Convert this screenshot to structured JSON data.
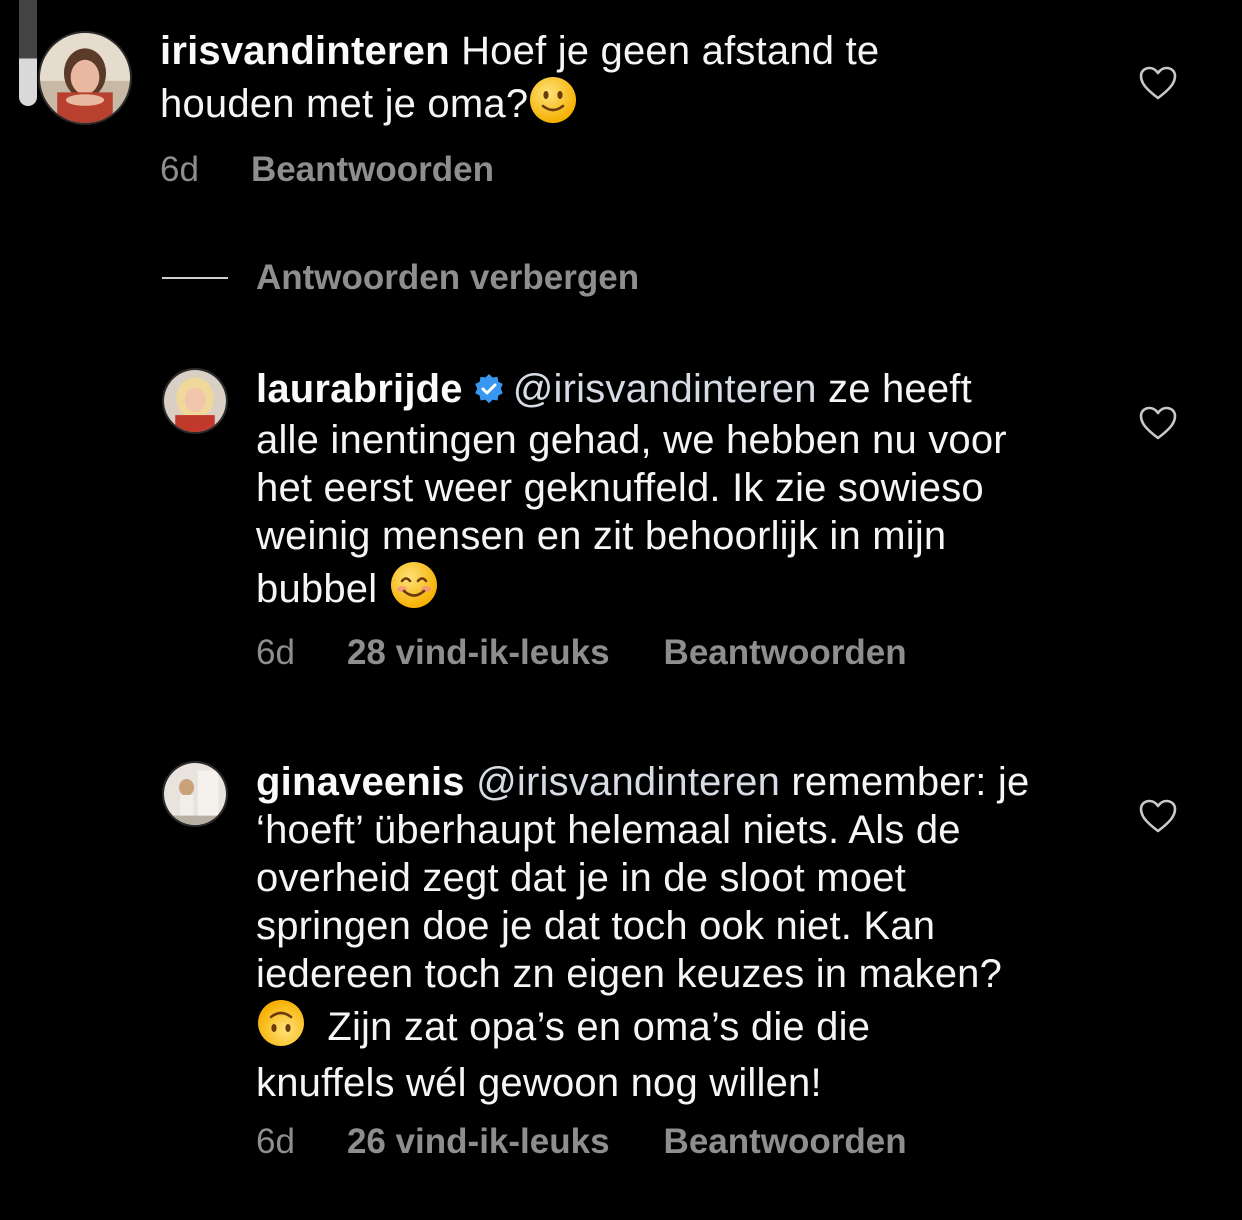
{
  "comments": [
    {
      "username": "irisvandinteren",
      "text_line1": "Hoef je geen afstand te",
      "text_line2": "houden met je oma?",
      "emoji": "slightly-smiling-face",
      "time": "6d",
      "reply_label": "Beantwoorden"
    }
  ],
  "hide_replies_label": "Antwoorden verbergen",
  "replies": [
    {
      "username": "laurabrijde",
      "verified": true,
      "mention": "@irisvandinteren",
      "text_after_mention": "ze heeft",
      "line2": "alle inentingen gehad, we hebben nu voor",
      "line3": "het eerst weer geknuffeld. Ik zie sowieso",
      "line4": "weinig mensen en zit behoorlijk in mijn",
      "line5": "bubbel",
      "emoji": "smiling-face-with-smiling-eyes",
      "time": "6d",
      "likes": "28 vind-ik-leuks",
      "reply_label": "Beantwoorden"
    },
    {
      "username": "ginaveenis",
      "mention": "@irisvandinteren",
      "text_after_mention": "remember: je",
      "line2": "‘hoeft’ überhaupt helemaal niets. Als de",
      "line3": "overheid zegt dat je in de sloot moet",
      "line4": "springen doe je dat toch ook niet. Kan",
      "line5": "iedereen toch zn eigen keuzes in maken?",
      "emoji": "upside-down-face",
      "line6_after_emoji": "Zijn zat opa’s en oma’s die die",
      "line7": "knuffels wél gewoon nog willen!",
      "time": "6d",
      "likes": "26 vind-ik-leuks",
      "reply_label": "Beantwoorden"
    }
  ],
  "icons": {
    "like": "heart-outline-icon",
    "verified": "verified-badge-icon"
  },
  "colors": {
    "background": "#000000",
    "text": "#f5f5f5",
    "secondary": "#8e8e8e",
    "verified": "#3897f0",
    "emoji": "#fcc419"
  }
}
